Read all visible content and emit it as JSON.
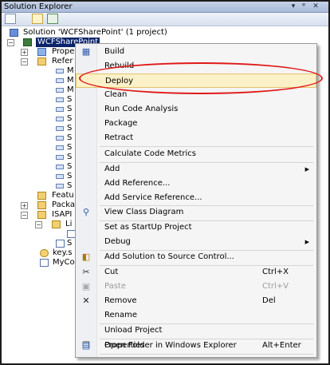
{
  "window": {
    "title": "Solution Explorer",
    "pin_glyph": "▾",
    "pushpin_glyph": "ᵠ",
    "close_glyph": "✕"
  },
  "tree": {
    "solution_label": "Solution 'WCFSharePoint' (1 project)",
    "project_label": "WCFSharePoint",
    "properties_label": "Prope",
    "references_label": "Refer",
    "ref_items": [
      {
        "label": "M"
      },
      {
        "label": "M"
      },
      {
        "label": "M"
      },
      {
        "label": "S"
      },
      {
        "label": "S"
      },
      {
        "label": "S"
      },
      {
        "label": "S"
      },
      {
        "label": "S"
      },
      {
        "label": "S"
      },
      {
        "label": "S"
      },
      {
        "label": "S"
      },
      {
        "label": "S"
      },
      {
        "label": "S"
      }
    ],
    "features_label": "Featu",
    "package_label": "Packa",
    "isapi_label": "ISAPI",
    "li_label": "Li",
    "s_label": "S",
    "key_label": "key.s",
    "myco_label": "MyCo"
  },
  "menu": {
    "items": [
      {
        "label": "Build",
        "shortcut": "",
        "icon": "build-icon",
        "glyph": "▦"
      },
      {
        "label": "Rebuild",
        "shortcut": "",
        "icon": "",
        "glyph": ""
      },
      {
        "label": "Deploy",
        "shortcut": "",
        "icon": "",
        "glyph": ""
      },
      {
        "label": "Clean",
        "shortcut": "",
        "icon": "",
        "glyph": ""
      },
      {
        "label": "Run Code Analysis",
        "shortcut": "",
        "icon": "",
        "glyph": ""
      },
      {
        "label": "Package",
        "shortcut": "",
        "icon": "",
        "glyph": ""
      },
      {
        "label": "Retract",
        "shortcut": "",
        "icon": "",
        "glyph": ""
      },
      {
        "label": "Calculate Code Metrics",
        "shortcut": "",
        "icon": "",
        "glyph": ""
      },
      {
        "label": "Add",
        "shortcut": "",
        "icon": "",
        "glyph": ""
      },
      {
        "label": "Add Reference...",
        "shortcut": "",
        "icon": "",
        "glyph": ""
      },
      {
        "label": "Add Service Reference...",
        "shortcut": "",
        "icon": "",
        "glyph": ""
      },
      {
        "label": "View Class Diagram",
        "shortcut": "",
        "icon": "class-diagram-icon",
        "glyph": "⚲"
      },
      {
        "label": "Set as StartUp Project",
        "shortcut": "",
        "icon": "",
        "glyph": ""
      },
      {
        "label": "Debug",
        "shortcut": "",
        "icon": "",
        "glyph": ""
      },
      {
        "label": "Add Solution to Source Control...",
        "shortcut": "",
        "icon": "source-control-icon",
        "glyph": "◧"
      },
      {
        "label": "Cut",
        "shortcut": "Ctrl+X",
        "icon": "scissors-icon",
        "glyph": "✂"
      },
      {
        "label": "Paste",
        "shortcut": "Ctrl+V",
        "icon": "paste-icon",
        "glyph": "▣"
      },
      {
        "label": "Remove",
        "shortcut": "Del",
        "icon": "remove-icon",
        "glyph": "✕"
      },
      {
        "label": "Rename",
        "shortcut": "",
        "icon": "",
        "glyph": ""
      },
      {
        "label": "Unload Project",
        "shortcut": "",
        "icon": "",
        "glyph": ""
      },
      {
        "label": "Open Folder in Windows Explorer",
        "shortcut": "",
        "icon": "folder-open-icon",
        "glyph": "❐"
      },
      {
        "label": "Properties",
        "shortcut": "Alt+Enter",
        "icon": "properties-icon",
        "glyph": "▤"
      }
    ],
    "submenu_glyph": "▶",
    "highlighted_item": "Deploy",
    "disabled_item": "Paste"
  },
  "colors": {
    "callout": "#e01a1a",
    "highlight_bg": "#fbf1c8",
    "selection": "#0a246a"
  }
}
